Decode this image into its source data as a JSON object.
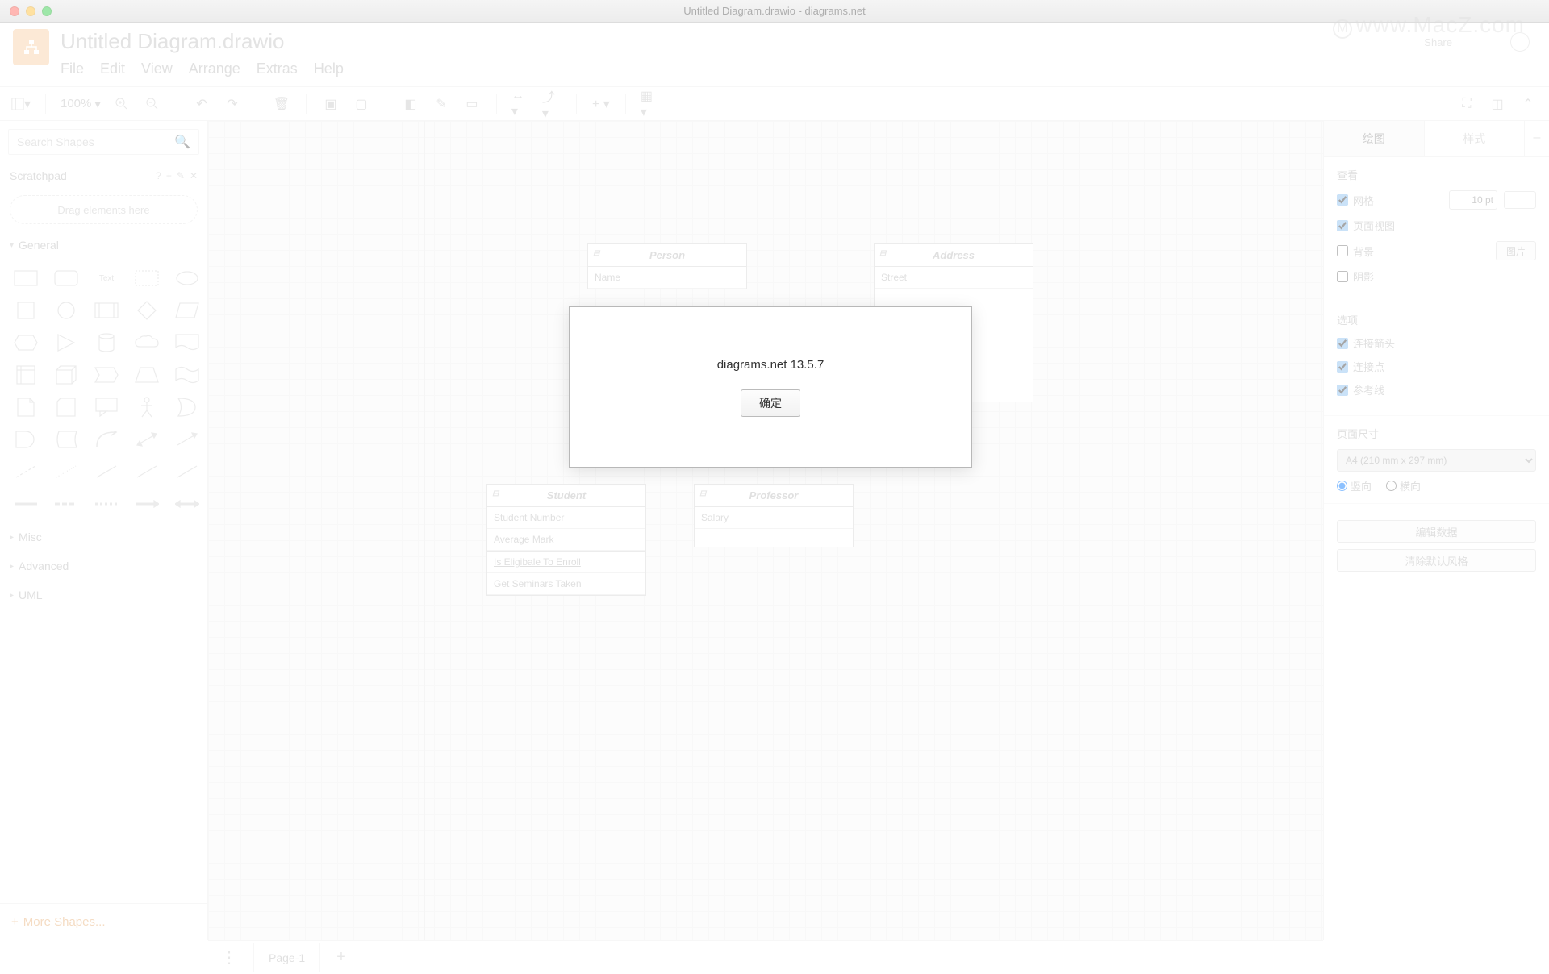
{
  "window_title": "Untitled Diagram.drawio - diagrams.net",
  "watermark": "www.MacZ.com",
  "doc_title": "Untitled Diagram.drawio",
  "menu": {
    "file": "File",
    "edit": "Edit",
    "view": "View",
    "arrange": "Arrange",
    "extras": "Extras",
    "help": "Help"
  },
  "toolbar": {
    "zoom": "100%"
  },
  "share": "Share",
  "sidebar": {
    "search_placeholder": "Search Shapes",
    "scratchpad": "Scratchpad",
    "drag_hint": "Drag elements here",
    "general": "General",
    "misc": "Misc",
    "advanced": "Advanced",
    "uml": "UML",
    "more_shapes": "More Shapes..."
  },
  "canvas": {
    "person": {
      "title": "Person",
      "row0": "Name"
    },
    "address": {
      "title": "Address",
      "row0": "Street"
    },
    "student": {
      "title": "Student",
      "row0": "Student Number",
      "row1": "Average Mark",
      "row2": "Is Eligibale To Enroll",
      "row3": "Get Seminars Taken"
    },
    "professor": {
      "title": "Professor",
      "row0": "Salary"
    }
  },
  "right": {
    "tab_diagram": "绘图",
    "tab_style": "样式",
    "view": "查看",
    "grid": "网格",
    "grid_value": "10 pt",
    "page_view": "页面视图",
    "background": "背景",
    "image_btn": "图片",
    "shadow": "阴影",
    "options": "选项",
    "connect_arrows": "连接箭头",
    "connect_points": "连接点",
    "guides": "参考线",
    "page_size": "页面尺寸",
    "page_option": "A4 (210 mm x 297 mm)",
    "portrait": "竖向",
    "landscape": "横向",
    "edit_data": "编辑数据",
    "clear_style": "清除默认风格"
  },
  "bottom": {
    "page1": "Page-1"
  },
  "dialog": {
    "message": "diagrams.net 13.5.7",
    "ok": "确定"
  }
}
